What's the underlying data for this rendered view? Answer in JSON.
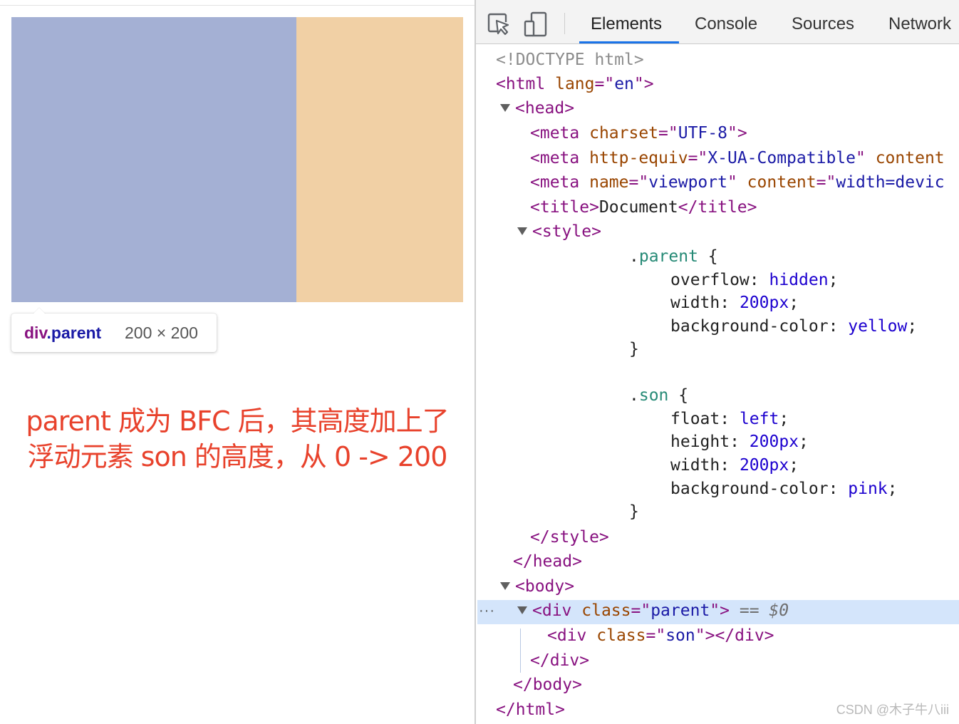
{
  "preview": {
    "tooltip": {
      "tag_name": "div",
      "class_name": ".parent",
      "size": "200 × 200"
    },
    "note_line1": "parent 成为 BFC 后，其高度加上了",
    "note_line2": "浮动元素 son 的高度，从 0 -> 200",
    "colors": {
      "son": "#a4b0d4",
      "parent": "#f1d0a5",
      "note": "#e8422c"
    }
  },
  "devtools": {
    "toolbar": {
      "inspect_icon": "cursor-in-box-icon",
      "device_icon": "device-toggle-icon",
      "tabs": [
        {
          "label": "Elements",
          "active": true
        },
        {
          "label": "Console",
          "active": false
        },
        {
          "label": "Sources",
          "active": false
        },
        {
          "label": "Network",
          "active": false
        }
      ]
    },
    "dom": {
      "doctype": "<!DOCTYPE html>",
      "html_lang": "en",
      "meta_charset": "UTF-8",
      "meta_http_equiv": "X-UA-Compatible",
      "meta_http_equiv_rest": " content",
      "meta_name": "viewport",
      "meta_name_rest": " content=\"width=devic",
      "title_text": "Document",
      "css": {
        "parent_selector": ".parent",
        "parent_rules": [
          {
            "prop": "overflow",
            "value": "hidden"
          },
          {
            "prop": "width",
            "value": "200px"
          },
          {
            "prop": "background-color",
            "value": "yellow"
          }
        ],
        "son_selector": ".son",
        "son_rules": [
          {
            "prop": "float",
            "value": "left"
          },
          {
            "prop": "height",
            "value": "200px"
          },
          {
            "prop": "width",
            "value": "200px"
          },
          {
            "prop": "background-color",
            "value": "pink"
          }
        ]
      },
      "body_div_class": "parent",
      "selected_marker": "== $0",
      "child_div_class": "son",
      "ellipsis": "···"
    },
    "watermark": "CSDN @木子牛八iii"
  }
}
